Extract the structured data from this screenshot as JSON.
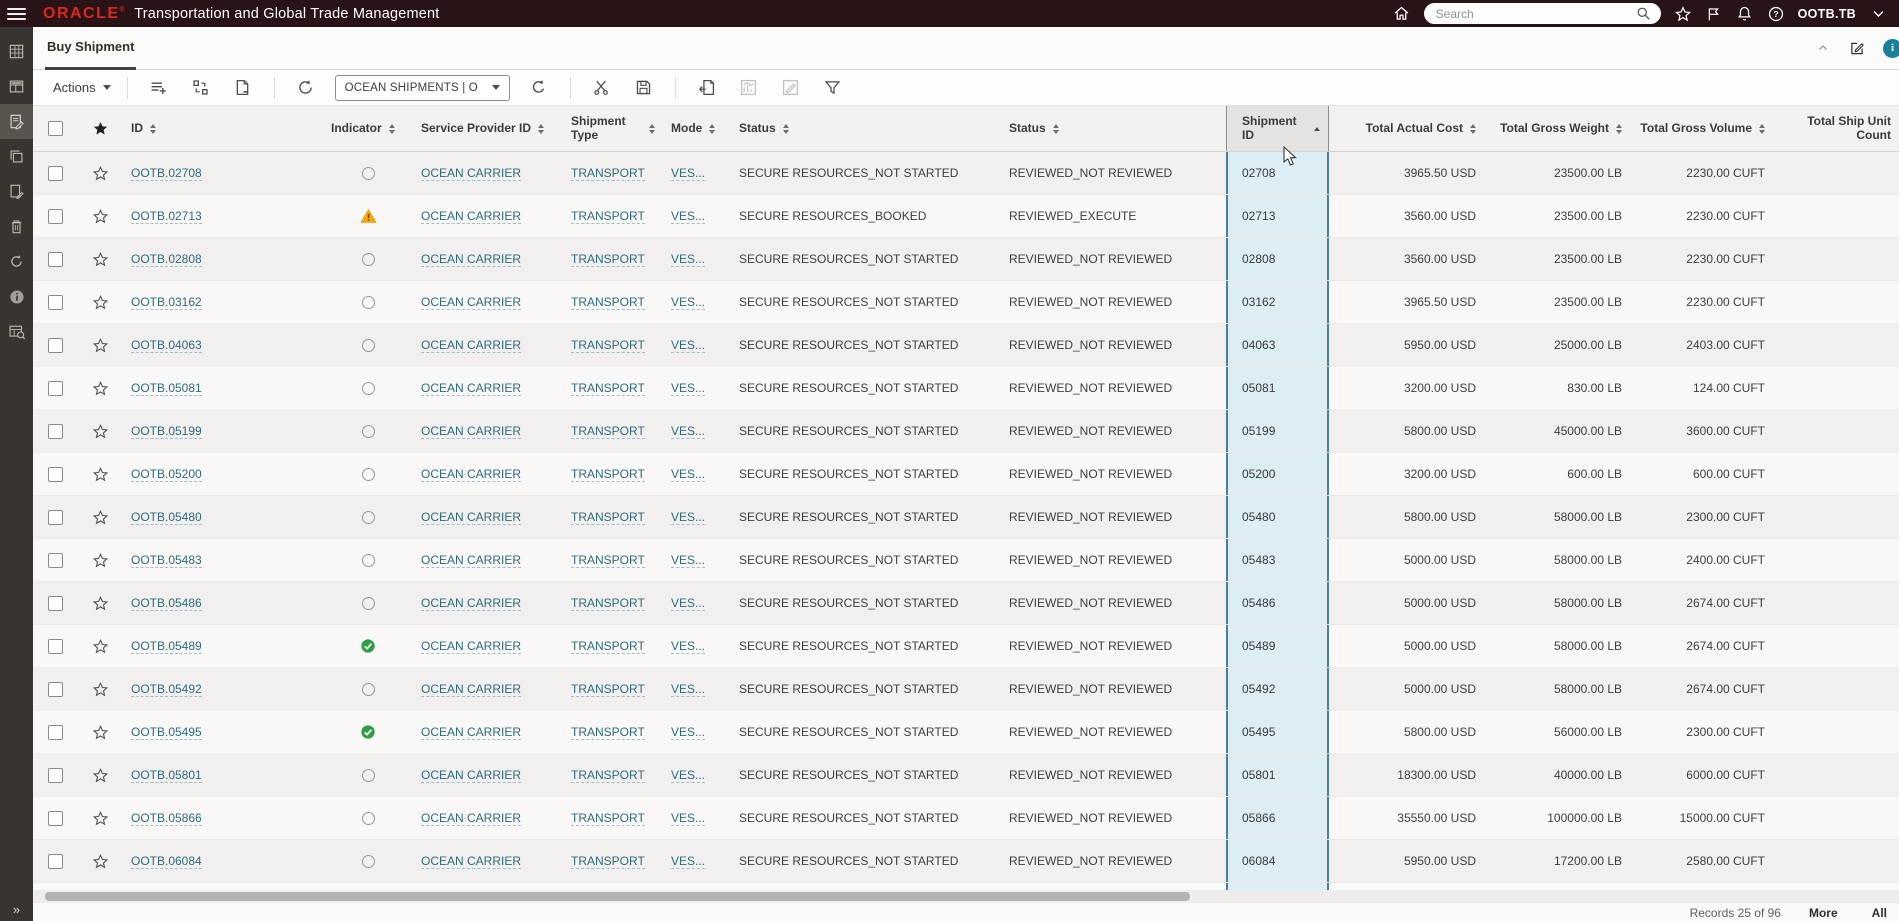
{
  "header": {
    "brand": "ORACLE",
    "brand_mark": "®",
    "title": "Transportation and Global Trade Management",
    "search_placeholder": "Search",
    "username": "OOTB.TB",
    "icons": [
      "menu-icon",
      "home-icon",
      "search-icon",
      "favorites-star-icon",
      "flag-icon",
      "notifications-bell-icon",
      "help-icon",
      "user-menu-chevron-icon"
    ]
  },
  "sidebar": {
    "icons": [
      "spreadsheet-icon",
      "workbench-icon",
      "shipment-manager-icon",
      "copy-icon",
      "document-edit-icon",
      "delete-icon",
      "refresh-icon",
      "info-icon",
      "table-search-icon"
    ],
    "selected_index": 2,
    "expander": "»"
  },
  "tabbar": {
    "tab_label": "Buy Shipment",
    "right_icons": [
      "collapse-icon",
      "edit-page-icon",
      "info-dot"
    ],
    "info_dot_label": "i"
  },
  "toolbar": {
    "actions_label": "Actions",
    "saved_search_value": "OCEAN SHIPMENTS | O",
    "icons": [
      "add-to-list-icon",
      "bulk-actions-icon",
      "new-document-icon",
      "sync-icon",
      "refresh-icon",
      "cut-icon",
      "save-icon",
      "export-icon",
      "chart-icon-disabled",
      "edit-icon-disabled",
      "filter-icon"
    ]
  },
  "table": {
    "columns": [
      {
        "key": "select",
        "label": "",
        "sort": null
      },
      {
        "key": "favorite",
        "label": "",
        "sort": null
      },
      {
        "key": "id",
        "label": "ID",
        "sort": "both"
      },
      {
        "key": "indicator",
        "label": "Indicator",
        "sort": "both"
      },
      {
        "key": "service_provider",
        "label": "Service Provider ID",
        "sort": "both"
      },
      {
        "key": "shipment_type",
        "label": "Shipment Type",
        "sort": "both"
      },
      {
        "key": "mode",
        "label": "Mode",
        "sort": "both"
      },
      {
        "key": "status",
        "label": "Status",
        "sort": "both"
      },
      {
        "key": "status2",
        "label": "Status",
        "sort": "both"
      },
      {
        "key": "shipment_id",
        "label": "Shipment ID",
        "sort": "asc"
      },
      {
        "key": "total_actual_cost",
        "label": "Total Actual Cost",
        "sort": "both"
      },
      {
        "key": "total_gross_weight",
        "label": "Total Gross Weight",
        "sort": "both"
      },
      {
        "key": "total_gross_volume",
        "label": "Total Gross Volume",
        "sort": "both"
      },
      {
        "key": "total_ship_unit_count",
        "label": "Total Ship Unit Count",
        "sort": null
      }
    ],
    "rows": [
      {
        "id": "OOTB.02708",
        "indicator": "none",
        "service_provider": "OCEAN CARRIER",
        "shipment_type": "TRANSPORT",
        "mode": "VES...",
        "status": "SECURE RESOURCES_NOT STARTED",
        "status2": "REVIEWED_NOT REVIEWED",
        "shipment_id": "02708",
        "total_actual_cost": "3965.50 USD",
        "total_gross_weight": "23500.00 LB",
        "total_gross_volume": "2230.00 CUFT",
        "total_ship_unit_count": ""
      },
      {
        "id": "OOTB.02713",
        "indicator": "warning",
        "service_provider": "OCEAN CARRIER",
        "shipment_type": "TRANSPORT",
        "mode": "VES...",
        "status": "SECURE RESOURCES_BOOKED",
        "status2": "REVIEWED_EXECUTE",
        "shipment_id": "02713",
        "total_actual_cost": "3560.00 USD",
        "total_gross_weight": "23500.00 LB",
        "total_gross_volume": "2230.00 CUFT",
        "total_ship_unit_count": ""
      },
      {
        "id": "OOTB.02808",
        "indicator": "none",
        "service_provider": "OCEAN CARRIER",
        "shipment_type": "TRANSPORT",
        "mode": "VES...",
        "status": "SECURE RESOURCES_NOT STARTED",
        "status2": "REVIEWED_NOT REVIEWED",
        "shipment_id": "02808",
        "total_actual_cost": "3560.00 USD",
        "total_gross_weight": "23500.00 LB",
        "total_gross_volume": "2230.00 CUFT",
        "total_ship_unit_count": ""
      },
      {
        "id": "OOTB.03162",
        "indicator": "none",
        "service_provider": "OCEAN CARRIER",
        "shipment_type": "TRANSPORT",
        "mode": "VES...",
        "status": "SECURE RESOURCES_NOT STARTED",
        "status2": "REVIEWED_NOT REVIEWED",
        "shipment_id": "03162",
        "total_actual_cost": "3965.50 USD",
        "total_gross_weight": "23500.00 LB",
        "total_gross_volume": "2230.00 CUFT",
        "total_ship_unit_count": ""
      },
      {
        "id": "OOTB.04063",
        "indicator": "none",
        "service_provider": "OCEAN CARRIER",
        "shipment_type": "TRANSPORT",
        "mode": "VES...",
        "status": "SECURE RESOURCES_NOT STARTED",
        "status2": "REVIEWED_NOT REVIEWED",
        "shipment_id": "04063",
        "total_actual_cost": "5950.00 USD",
        "total_gross_weight": "25000.00 LB",
        "total_gross_volume": "2403.00 CUFT",
        "total_ship_unit_count": ""
      },
      {
        "id": "OOTB.05081",
        "indicator": "none",
        "service_provider": "OCEAN CARRIER",
        "shipment_type": "TRANSPORT",
        "mode": "VES...",
        "status": "SECURE RESOURCES_NOT STARTED",
        "status2": "REVIEWED_NOT REVIEWED",
        "shipment_id": "05081",
        "total_actual_cost": "3200.00 USD",
        "total_gross_weight": "830.00 LB",
        "total_gross_volume": "124.00 CUFT",
        "total_ship_unit_count": ""
      },
      {
        "id": "OOTB.05199",
        "indicator": "none",
        "service_provider": "OCEAN CARRIER",
        "shipment_type": "TRANSPORT",
        "mode": "VES...",
        "status": "SECURE RESOURCES_NOT STARTED",
        "status2": "REVIEWED_NOT REVIEWED",
        "shipment_id": "05199",
        "total_actual_cost": "5800.00 USD",
        "total_gross_weight": "45000.00 LB",
        "total_gross_volume": "3600.00 CUFT",
        "total_ship_unit_count": ""
      },
      {
        "id": "OOTB.05200",
        "indicator": "none",
        "service_provider": "OCEAN CARRIER",
        "shipment_type": "TRANSPORT",
        "mode": "VES...",
        "status": "SECURE RESOURCES_NOT STARTED",
        "status2": "REVIEWED_NOT REVIEWED",
        "shipment_id": "05200",
        "total_actual_cost": "3200.00 USD",
        "total_gross_weight": "600.00 LB",
        "total_gross_volume": "600.00 CUFT",
        "total_ship_unit_count": ""
      },
      {
        "id": "OOTB.05480",
        "indicator": "none",
        "service_provider": "OCEAN CARRIER",
        "shipment_type": "TRANSPORT",
        "mode": "VES...",
        "status": "SECURE RESOURCES_NOT STARTED",
        "status2": "REVIEWED_NOT REVIEWED",
        "shipment_id": "05480",
        "total_actual_cost": "5800.00 USD",
        "total_gross_weight": "58000.00 LB",
        "total_gross_volume": "2300.00 CUFT",
        "total_ship_unit_count": ""
      },
      {
        "id": "OOTB.05483",
        "indicator": "none",
        "service_provider": "OCEAN CARRIER",
        "shipment_type": "TRANSPORT",
        "mode": "VES...",
        "status": "SECURE RESOURCES_NOT STARTED",
        "status2": "REVIEWED_NOT REVIEWED",
        "shipment_id": "05483",
        "total_actual_cost": "5000.00 USD",
        "total_gross_weight": "58000.00 LB",
        "total_gross_volume": "2400.00 CUFT",
        "total_ship_unit_count": ""
      },
      {
        "id": "OOTB.05486",
        "indicator": "none",
        "service_provider": "OCEAN CARRIER",
        "shipment_type": "TRANSPORT",
        "mode": "VES...",
        "status": "SECURE RESOURCES_NOT STARTED",
        "status2": "REVIEWED_NOT REVIEWED",
        "shipment_id": "05486",
        "total_actual_cost": "5000.00 USD",
        "total_gross_weight": "58000.00 LB",
        "total_gross_volume": "2674.00 CUFT",
        "total_ship_unit_count": ""
      },
      {
        "id": "OOTB.05489",
        "indicator": "ok",
        "service_provider": "OCEAN CARRIER",
        "shipment_type": "TRANSPORT",
        "mode": "VES...",
        "status": "SECURE RESOURCES_NOT STARTED",
        "status2": "REVIEWED_NOT REVIEWED",
        "shipment_id": "05489",
        "total_actual_cost": "5000.00 USD",
        "total_gross_weight": "58000.00 LB",
        "total_gross_volume": "2674.00 CUFT",
        "total_ship_unit_count": ""
      },
      {
        "id": "OOTB.05492",
        "indicator": "none",
        "service_provider": "OCEAN CARRIER",
        "shipment_type": "TRANSPORT",
        "mode": "VES...",
        "status": "SECURE RESOURCES_NOT STARTED",
        "status2": "REVIEWED_NOT REVIEWED",
        "shipment_id": "05492",
        "total_actual_cost": "5000.00 USD",
        "total_gross_weight": "58000.00 LB",
        "total_gross_volume": "2674.00 CUFT",
        "total_ship_unit_count": ""
      },
      {
        "id": "OOTB.05495",
        "indicator": "ok",
        "service_provider": "OCEAN CARRIER",
        "shipment_type": "TRANSPORT",
        "mode": "VES...",
        "status": "SECURE RESOURCES_NOT STARTED",
        "status2": "REVIEWED_NOT REVIEWED",
        "shipment_id": "05495",
        "total_actual_cost": "5800.00 USD",
        "total_gross_weight": "56000.00 LB",
        "total_gross_volume": "2300.00 CUFT",
        "total_ship_unit_count": ""
      },
      {
        "id": "OOTB.05801",
        "indicator": "none",
        "service_provider": "OCEAN CARRIER",
        "shipment_type": "TRANSPORT",
        "mode": "VES...",
        "status": "SECURE RESOURCES_NOT STARTED",
        "status2": "REVIEWED_NOT REVIEWED",
        "shipment_id": "05801",
        "total_actual_cost": "18300.00 USD",
        "total_gross_weight": "40000.00 LB",
        "total_gross_volume": "6000.00 CUFT",
        "total_ship_unit_count": ""
      },
      {
        "id": "OOTB.05866",
        "indicator": "none",
        "service_provider": "OCEAN CARRIER",
        "shipment_type": "TRANSPORT",
        "mode": "VES...",
        "status": "SECURE RESOURCES_NOT STARTED",
        "status2": "REVIEWED_NOT REVIEWED",
        "shipment_id": "05866",
        "total_actual_cost": "35550.00 USD",
        "total_gross_weight": "100000.00 LB",
        "total_gross_volume": "15000.00 CUFT",
        "total_ship_unit_count": ""
      },
      {
        "id": "OOTB.06084",
        "indicator": "none",
        "service_provider": "OCEAN CARRIER",
        "shipment_type": "TRANSPORT",
        "mode": "VES...",
        "status": "SECURE RESOURCES_NOT STARTED",
        "status2": "REVIEWED_NOT REVIEWED",
        "shipment_id": "06084",
        "total_actual_cost": "5950.00 USD",
        "total_gross_weight": "17200.00 LB",
        "total_gross_volume": "2580.00 CUFT",
        "total_ship_unit_count": ""
      }
    ]
  },
  "footer": {
    "records": "Records 25 of 96",
    "more_label": "More",
    "all_label": "All"
  }
}
